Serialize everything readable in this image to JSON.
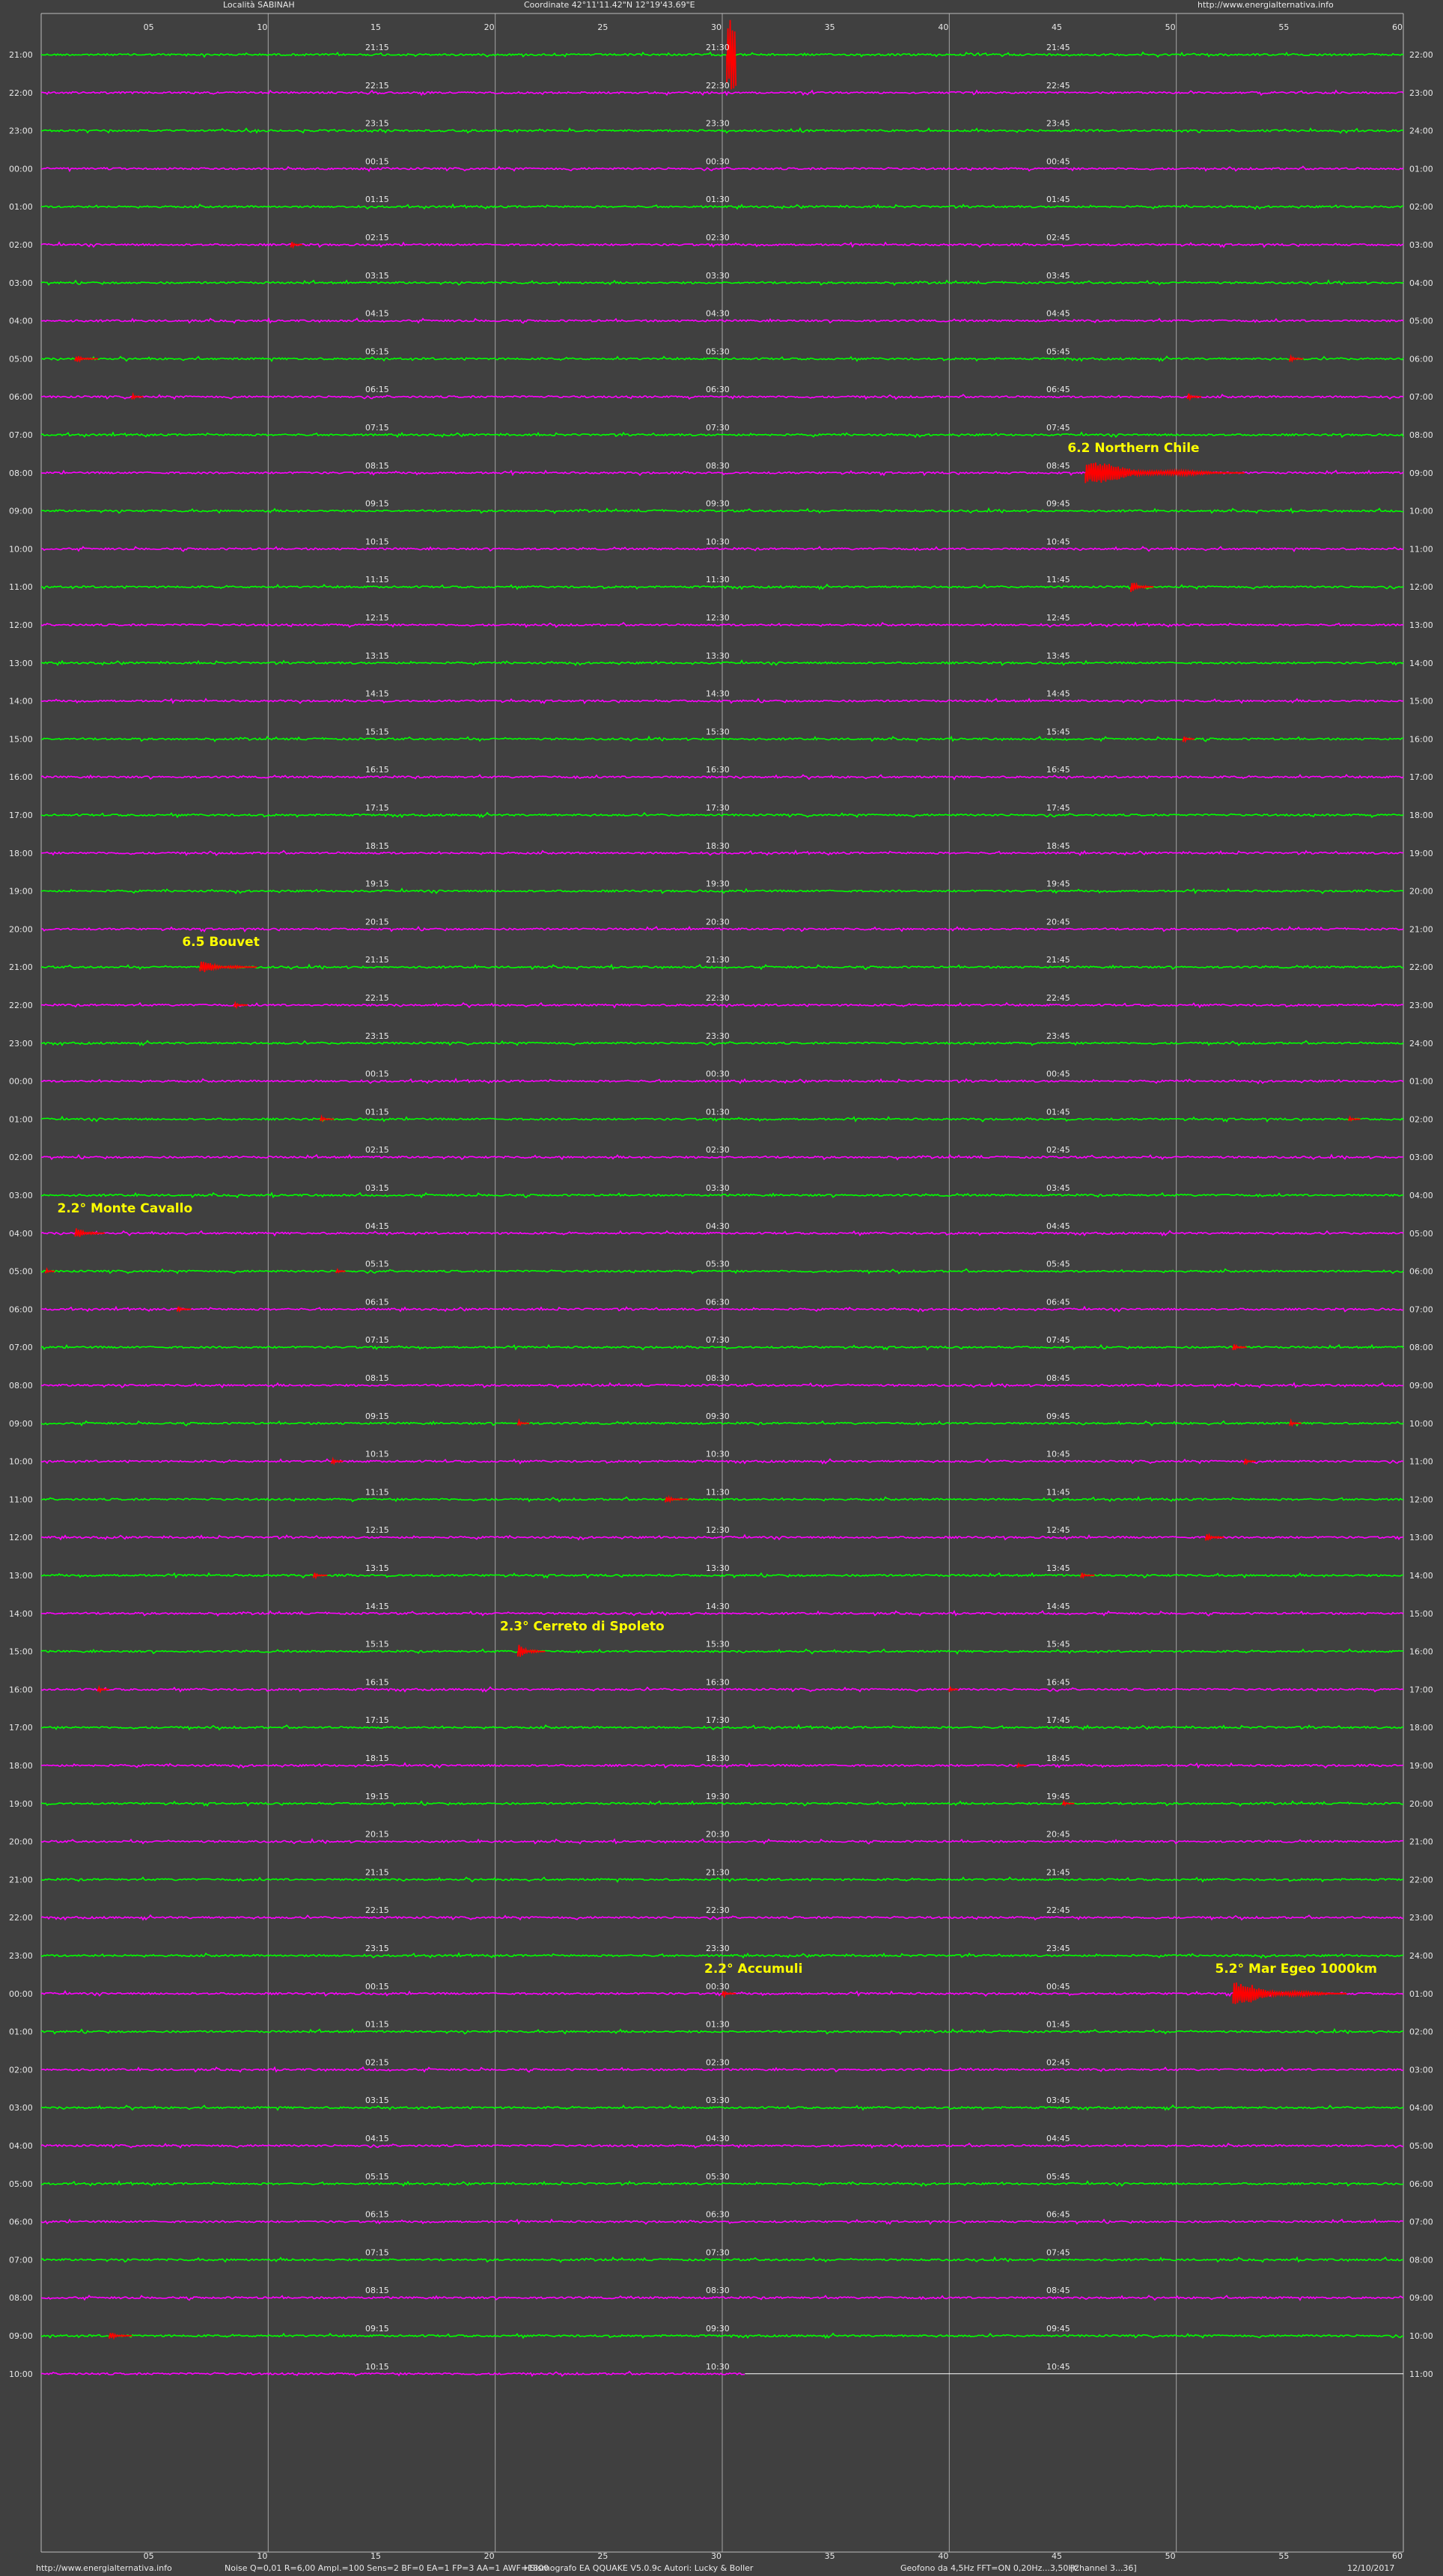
{
  "header": {
    "location": "Località SABINAH",
    "coordinates": "Coordinate 42°11'11.42\"N 12°19'43.69\"E",
    "website": "http://www.energialternativa.info"
  },
  "footer": {
    "website": "http://www.energialternativa.info",
    "params": "Noise Q=0,01 R=6,00 Ampl.=100 Sens=2 BF=0 EA=1 FP=3 AA=1 AWF=1800",
    "software": "HSismografo EA QQUAKE  V5.0.9c  Autori: Lucky & Boller",
    "sensor": "Geofono da 4,5Hz FFT=ON 0,20Hz...3,50Hz",
    "channel": "[Channel 3...36]",
    "date": "12/10/2017"
  },
  "colors": {
    "background": "#404040",
    "gridline": "#bdbdbd",
    "trace_even": "#00ff00",
    "trace_odd": "#ff00ff",
    "event": "#ff0000",
    "label": "#ffff00",
    "text": "#e8e8e8"
  },
  "chart_data": {
    "type": "line",
    "x_axis": {
      "unit": "minutes",
      "range": [
        0,
        60
      ],
      "tick_values": [
        5,
        10,
        15,
        20,
        25,
        30,
        35,
        40,
        45,
        50,
        55,
        60
      ],
      "tick_labels": [
        "05",
        "10",
        "15",
        "20",
        "25",
        "30",
        "35",
        "40",
        "45",
        "50",
        "55",
        "60"
      ]
    },
    "grid": true,
    "rows": [
      {
        "left": "21:00",
        "right": "22:00",
        "q1": "21:15",
        "q2": "21:30",
        "q3": "21:45"
      },
      {
        "left": "22:00",
        "right": "23:00",
        "q1": "22:15",
        "q2": "22:30",
        "q3": "22:45"
      },
      {
        "left": "23:00",
        "right": "24:00",
        "q1": "23:15",
        "q2": "23:30",
        "q3": "23:45"
      },
      {
        "left": "00:00",
        "right": "01:00",
        "q1": "00:15",
        "q2": "00:30",
        "q3": "00:45"
      },
      {
        "left": "01:00",
        "right": "02:00",
        "q1": "01:15",
        "q2": "01:30",
        "q3": "01:45"
      },
      {
        "left": "02:00",
        "right": "03:00",
        "q1": "02:15",
        "q2": "02:30",
        "q3": "02:45"
      },
      {
        "left": "03:00",
        "right": "04:00",
        "q1": "03:15",
        "q2": "03:30",
        "q3": "03:45"
      },
      {
        "left": "04:00",
        "right": "05:00",
        "q1": "04:15",
        "q2": "04:30",
        "q3": "04:45"
      },
      {
        "left": "05:00",
        "right": "06:00",
        "q1": "05:15",
        "q2": "05:30",
        "q3": "05:45"
      },
      {
        "left": "06:00",
        "right": "07:00",
        "q1": "06:15",
        "q2": "06:30",
        "q3": "06:45"
      },
      {
        "left": "07:00",
        "right": "08:00",
        "q1": "07:15",
        "q2": "07:30",
        "q3": "07:45"
      },
      {
        "left": "08:00",
        "right": "09:00",
        "q1": "08:15",
        "q2": "08:30",
        "q3": "08:45"
      },
      {
        "left": "09:00",
        "right": "10:00",
        "q1": "09:15",
        "q2": "09:30",
        "q3": "09:45"
      },
      {
        "left": "10:00",
        "right": "11:00",
        "q1": "10:15",
        "q2": "10:30",
        "q3": "10:45"
      },
      {
        "left": "11:00",
        "right": "12:00",
        "q1": "11:15",
        "q2": "11:30",
        "q3": "11:45"
      },
      {
        "left": "12:00",
        "right": "13:00",
        "q1": "12:15",
        "q2": "12:30",
        "q3": "12:45"
      },
      {
        "left": "13:00",
        "right": "14:00",
        "q1": "13:15",
        "q2": "13:30",
        "q3": "13:45"
      },
      {
        "left": "14:00",
        "right": "15:00",
        "q1": "14:15",
        "q2": "14:30",
        "q3": "14:45"
      },
      {
        "left": "15:00",
        "right": "16:00",
        "q1": "15:15",
        "q2": "15:30",
        "q3": "15:45"
      },
      {
        "left": "16:00",
        "right": "17:00",
        "q1": "16:15",
        "q2": "16:30",
        "q3": "16:45"
      },
      {
        "left": "17:00",
        "right": "18:00",
        "q1": "17:15",
        "q2": "17:30",
        "q3": "17:45"
      },
      {
        "left": "18:00",
        "right": "19:00",
        "q1": "18:15",
        "q2": "18:30",
        "q3": "18:45"
      },
      {
        "left": "19:00",
        "right": "20:00",
        "q1": "19:15",
        "q2": "19:30",
        "q3": "19:45"
      },
      {
        "left": "20:00",
        "right": "21:00",
        "q1": "20:15",
        "q2": "20:30",
        "q3": "20:45"
      },
      {
        "left": "21:00",
        "right": "22:00",
        "q1": "21:15",
        "q2": "21:30",
        "q3": "21:45"
      },
      {
        "left": "22:00",
        "right": "23:00",
        "q1": "22:15",
        "q2": "22:30",
        "q3": "22:45"
      },
      {
        "left": "23:00",
        "right": "24:00",
        "q1": "23:15",
        "q2": "23:30",
        "q3": "23:45"
      },
      {
        "left": "00:00",
        "right": "01:00",
        "q1": "00:15",
        "q2": "00:30",
        "q3": "00:45"
      },
      {
        "left": "01:00",
        "right": "02:00",
        "q1": "01:15",
        "q2": "01:30",
        "q3": "01:45"
      },
      {
        "left": "02:00",
        "right": "03:00",
        "q1": "02:15",
        "q2": "02:30",
        "q3": "02:45"
      },
      {
        "left": "03:00",
        "right": "04:00",
        "q1": "03:15",
        "q2": "03:30",
        "q3": "03:45"
      },
      {
        "left": "04:00",
        "right": "05:00",
        "q1": "04:15",
        "q2": "04:30",
        "q3": "04:45"
      },
      {
        "left": "05:00",
        "right": "06:00",
        "q1": "05:15",
        "q2": "05:30",
        "q3": "05:45"
      },
      {
        "left": "06:00",
        "right": "07:00",
        "q1": "06:15",
        "q2": "06:30",
        "q3": "06:45"
      },
      {
        "left": "07:00",
        "right": "08:00",
        "q1": "07:15",
        "q2": "07:30",
        "q3": "07:45"
      },
      {
        "left": "08:00",
        "right": "09:00",
        "q1": "08:15",
        "q2": "08:30",
        "q3": "08:45"
      },
      {
        "left": "09:00",
        "right": "10:00",
        "q1": "09:15",
        "q2": "09:30",
        "q3": "09:45"
      },
      {
        "left": "10:00",
        "right": "11:00",
        "q1": "10:15",
        "q2": "10:30",
        "q3": "10:45"
      },
      {
        "left": "11:00",
        "right": "12:00",
        "q1": "11:15",
        "q2": "11:30",
        "q3": "11:45"
      },
      {
        "left": "12:00",
        "right": "13:00",
        "q1": "12:15",
        "q2": "12:30",
        "q3": "12:45"
      },
      {
        "left": "13:00",
        "right": "14:00",
        "q1": "13:15",
        "q2": "13:30",
        "q3": "13:45"
      },
      {
        "left": "14:00",
        "right": "15:00",
        "q1": "14:15",
        "q2": "14:30",
        "q3": "14:45"
      },
      {
        "left": "15:00",
        "right": "16:00",
        "q1": "15:15",
        "q2": "15:30",
        "q3": "15:45"
      },
      {
        "left": "16:00",
        "right": "17:00",
        "q1": "16:15",
        "q2": "16:30",
        "q3": "16:45"
      },
      {
        "left": "17:00",
        "right": "18:00",
        "q1": "17:15",
        "q2": "17:30",
        "q3": "17:45"
      },
      {
        "left": "18:00",
        "right": "19:00",
        "q1": "18:15",
        "q2": "18:30",
        "q3": "18:45"
      },
      {
        "left": "19:00",
        "right": "20:00",
        "q1": "19:15",
        "q2": "19:30",
        "q3": "19:45"
      },
      {
        "left": "20:00",
        "right": "21:00",
        "q1": "20:15",
        "q2": "20:30",
        "q3": "20:45"
      },
      {
        "left": "21:00",
        "right": "22:00",
        "q1": "21:15",
        "q2": "21:30",
        "q3": "21:45"
      },
      {
        "left": "22:00",
        "right": "23:00",
        "q1": "22:15",
        "q2": "22:30",
        "q3": "22:45"
      },
      {
        "left": "23:00",
        "right": "24:00",
        "q1": "23:15",
        "q2": "23:30",
        "q3": "23:45"
      },
      {
        "left": "00:00",
        "right": "01:00",
        "q1": "00:15",
        "q2": "00:30",
        "q3": "00:45"
      },
      {
        "left": "01:00",
        "right": "02:00",
        "q1": "01:15",
        "q2": "01:30",
        "q3": "01:45"
      },
      {
        "left": "02:00",
        "right": "03:00",
        "q1": "02:15",
        "q2": "02:30",
        "q3": "02:45"
      },
      {
        "left": "03:00",
        "right": "04:00",
        "q1": "03:15",
        "q2": "03:30",
        "q3": "03:45"
      },
      {
        "left": "04:00",
        "right": "05:00",
        "q1": "04:15",
        "q2": "04:30",
        "q3": "04:45"
      },
      {
        "left": "05:00",
        "right": "06:00",
        "q1": "05:15",
        "q2": "05:30",
        "q3": "05:45"
      },
      {
        "left": "06:00",
        "right": "07:00",
        "q1": "06:15",
        "q2": "06:30",
        "q3": "06:45"
      },
      {
        "left": "07:00",
        "right": "08:00",
        "q1": "07:15",
        "q2": "07:30",
        "q3": "07:45"
      },
      {
        "left": "08:00",
        "right": "09:00",
        "q1": "08:15",
        "q2": "08:30",
        "q3": "08:45"
      },
      {
        "left": "09:00",
        "right": "10:00",
        "q1": "09:15",
        "q2": "09:30",
        "q3": "09:45"
      },
      {
        "left": "10:00",
        "right": "11:00",
        "q1": "10:15",
        "q2": "10:30",
        "q3": "10:45"
      }
    ],
    "events": [
      {
        "row": 0,
        "minute": 30.2,
        "duration": 0.4,
        "amplitude": 12,
        "label": ""
      },
      {
        "row": 5,
        "minute": 11.0,
        "duration": 0.5,
        "amplitude": 1.5,
        "label": ""
      },
      {
        "row": 8,
        "minute": 1.5,
        "duration": 1.0,
        "amplitude": 1.5,
        "label": ""
      },
      {
        "row": 8,
        "minute": 55.0,
        "duration": 0.6,
        "amplitude": 1.5,
        "label": ""
      },
      {
        "row": 9,
        "minute": 4.0,
        "duration": 0.5,
        "amplitude": 1.2,
        "label": ""
      },
      {
        "row": 9,
        "minute": 50.5,
        "duration": 0.6,
        "amplitude": 1.5,
        "label": ""
      },
      {
        "row": 11,
        "minute": 46.0,
        "duration": 7.0,
        "amplitude": 5,
        "label": "6.2 Northern Chile"
      },
      {
        "row": 14,
        "minute": 48.0,
        "duration": 1.0,
        "amplitude": 2.5,
        "label": ""
      },
      {
        "row": 18,
        "minute": 50.3,
        "duration": 0.5,
        "amplitude": 1.5,
        "label": ""
      },
      {
        "row": 24,
        "minute": 7.0,
        "duration": 2.5,
        "amplitude": 2.5,
        "label": "6.5 Bouvet"
      },
      {
        "row": 25,
        "minute": 8.5,
        "duration": 0.6,
        "amplitude": 1.2,
        "label": ""
      },
      {
        "row": 28,
        "minute": 12.3,
        "duration": 0.6,
        "amplitude": 1.2,
        "label": ""
      },
      {
        "row": 28,
        "minute": 57.6,
        "duration": 0.5,
        "amplitude": 1.2,
        "label": ""
      },
      {
        "row": 31,
        "minute": 1.5,
        "duration": 1.3,
        "amplitude": 2.2,
        "label": "2.2° Monte Cavallo"
      },
      {
        "row": 32,
        "minute": 0.2,
        "duration": 0.4,
        "amplitude": 1.2,
        "label": ""
      },
      {
        "row": 32,
        "minute": 13.0,
        "duration": 0.4,
        "amplitude": 1.2,
        "label": ""
      },
      {
        "row": 33,
        "minute": 6.0,
        "duration": 0.6,
        "amplitude": 1.2,
        "label": ""
      },
      {
        "row": 34,
        "minute": 52.5,
        "duration": 0.6,
        "amplitude": 1.5,
        "label": ""
      },
      {
        "row": 36,
        "minute": 21.0,
        "duration": 0.5,
        "amplitude": 1.2,
        "label": ""
      },
      {
        "row": 36,
        "minute": 55.0,
        "duration": 0.5,
        "amplitude": 1.2,
        "label": ""
      },
      {
        "row": 37,
        "minute": 12.8,
        "duration": 0.5,
        "amplitude": 1.5,
        "label": ""
      },
      {
        "row": 37,
        "minute": 53.0,
        "duration": 0.5,
        "amplitude": 1.5,
        "label": ""
      },
      {
        "row": 38,
        "minute": 27.5,
        "duration": 1.0,
        "amplitude": 1.5,
        "label": ""
      },
      {
        "row": 39,
        "minute": 51.3,
        "duration": 0.8,
        "amplitude": 1.8,
        "label": ""
      },
      {
        "row": 40,
        "minute": 12.0,
        "duration": 0.6,
        "amplitude": 1.2,
        "label": ""
      },
      {
        "row": 40,
        "minute": 45.8,
        "duration": 0.6,
        "amplitude": 1.2,
        "label": ""
      },
      {
        "row": 42,
        "minute": 21.0,
        "duration": 1.2,
        "amplitude": 3,
        "label": "2.3° Cerreto di Spoleto"
      },
      {
        "row": 43,
        "minute": 2.5,
        "duration": 0.5,
        "amplitude": 1.5,
        "label": ""
      },
      {
        "row": 43,
        "minute": 40.0,
        "duration": 0.4,
        "amplitude": 1.2,
        "label": ""
      },
      {
        "row": 45,
        "minute": 43.0,
        "duration": 0.4,
        "amplitude": 1.2,
        "label": ""
      },
      {
        "row": 46,
        "minute": 45.0,
        "duration": 0.5,
        "amplitude": 1.2,
        "label": ""
      },
      {
        "row": 51,
        "minute": 30.0,
        "duration": 0.6,
        "amplitude": 1.5,
        "label": "2.2° Accumuli"
      },
      {
        "row": 51,
        "minute": 52.5,
        "duration": 5.0,
        "amplitude": 5,
        "label": "5.2° Mar Egeo 1000km"
      },
      {
        "row": 60,
        "minute": 3.0,
        "duration": 1.0,
        "amplitude": 1.5,
        "label": ""
      }
    ]
  }
}
